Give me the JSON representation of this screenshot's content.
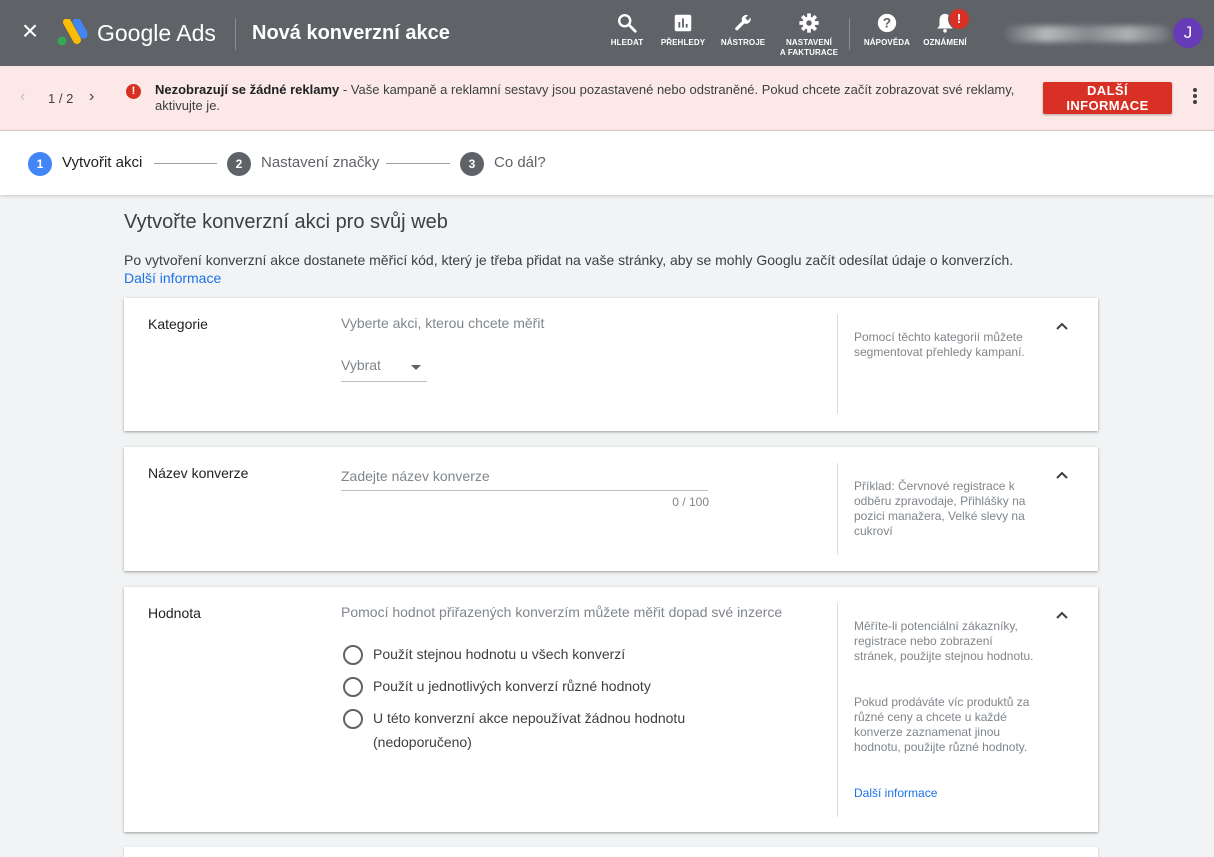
{
  "header": {
    "brand": "Google Ads",
    "title": "Nová konverzní akce",
    "tools": [
      {
        "label": "HLEDAT",
        "icon": "search-icon"
      },
      {
        "label": "PŘEHLEDY",
        "icon": "reports-icon"
      },
      {
        "label": "NÁSTROJE",
        "icon": "wrench-icon"
      },
      {
        "label1": "NASTAVENÍ",
        "label2": "A FAKTURACE",
        "icon": "gear-icon"
      },
      {
        "label": "NÁPOVĚDA",
        "icon": "help-icon"
      },
      {
        "label": "OZNÁMENÍ",
        "icon": "bell-icon",
        "badge": "!"
      }
    ],
    "avatar_initial": "J"
  },
  "alert": {
    "page": "1 / 2",
    "bold": "Nezobrazují se žádné reklamy",
    "text": " - Vaše kampaně a reklamní sestavy jsou pozastavené nebo odstraněné. Pokud chcete začít zobrazovat své reklamy, aktivujte je.",
    "button": "DALŠÍ INFORMACE"
  },
  "stepper": {
    "steps": [
      {
        "number": "1",
        "label": "Vytvořit akci",
        "active": true
      },
      {
        "number": "2",
        "label": "Nastavení značky",
        "active": false
      },
      {
        "number": "3",
        "label": "Co dál?",
        "active": false
      }
    ]
  },
  "main": {
    "heading": "Vytvořte konverzní akci pro svůj web",
    "description": "Po vytvoření konverzní akce dostanete měřicí kód, který je třeba přidat na vaše stránky, aby se mohly Googlu začít odesílat údaje o konverzích.",
    "description_link": "Další informace"
  },
  "cards": {
    "category": {
      "label": "Kategorie",
      "hint": "Vyberte akci, kterou chcete měřit",
      "select_value": "Vybrat",
      "help": "Pomocí těchto kategorií můžete segmentovat přehledy kampaní."
    },
    "name": {
      "label": "Název konverze",
      "placeholder": "Zadejte název konverze",
      "value": "",
      "counter": "0 / 100",
      "help": "Příklad: Červnové registrace k odběru zpravodaje, Přihlášky na pozici manažera, Velké slevy na cukroví"
    },
    "value": {
      "label": "Hodnota",
      "hint": "Pomocí hodnot přiřazených konverzím můžete měřit dopad své inzerce",
      "options": [
        "Použít stejnou hodnotu u všech konverzí",
        "Použít u jednotlivých konverzí různé hodnoty",
        "U této konverzní akce nepoužívat žádnou hodnotu (nedoporučeno)"
      ],
      "help1": "Měříte-li potenciální zákazníky, registrace nebo zobrazení stránek, použijte stejnou hodnotu.",
      "help2": "Pokud prodáváte víc produktů za různé ceny a chcete u každé konverze zaznamenat jinou hodnotu, použijte různé hodnoty.",
      "help_link": "Další informace"
    }
  },
  "colors": {
    "header_bg": "#5f6368",
    "alert_bg": "#fce8e6",
    "alert_button": "#d93025",
    "step_active": "#4285f4",
    "step_inactive": "#5f6368",
    "link": "#1a73e8",
    "avatar": "#673ab7"
  }
}
